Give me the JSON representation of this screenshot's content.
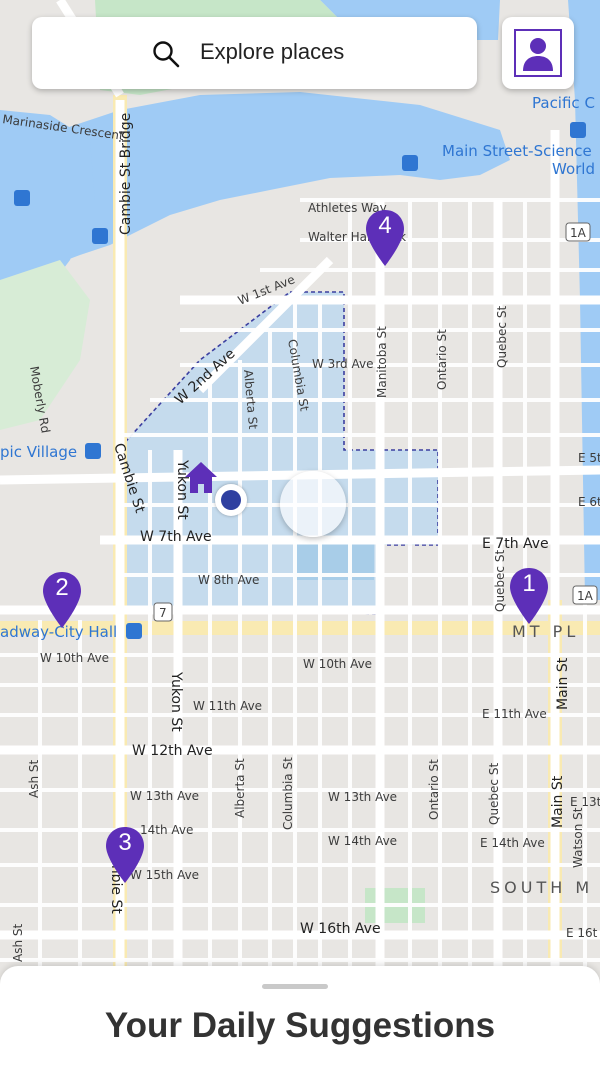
{
  "search": {
    "placeholder": "Explore places"
  },
  "map": {
    "labels": {
      "marinaside": "Marinaside Crescent",
      "cambie_bridge": "Cambie St Bridge",
      "pacific_top": "Pacific C",
      "science_world_1": "Main Street-Science",
      "science_world_2": "World",
      "athletes_way": "Athletes Way",
      "walter_hardwick": "Walter Hardwick",
      "w1st": "W 1st Ave",
      "w2nd": "W 2nd Ave",
      "w3rd": "W 3rd Ave",
      "w7th": "W 7th Ave",
      "w8th": "W 8th Ave",
      "w10th": "W 10th Ave",
      "w10th_b": "W 10th Ave",
      "w11th": "W 11th Ave",
      "e11th": "E 11th Ave",
      "w12th": "W 12th Ave",
      "w13th": "W 13th Ave",
      "w13th_b": "W 13th Ave",
      "w14th": "14th Ave",
      "w14th_b": "W 14th Ave",
      "e14th": "E 14th Ave",
      "w15th": "W 15th Ave",
      "w16th": "W 16th Ave",
      "e16th": "E 16t",
      "e7th": "E 7th Ave",
      "e5th": "E 5t",
      "e6th": "E 6t",
      "e13th": "E 13t",
      "pacific_village": "pic Village",
      "broadway": "adway-City Hall",
      "mt_pl": "MT PL",
      "south": "SOUTH M",
      "columbia": "Columbia St",
      "alberta": "Alberta St",
      "yukon": "Yukon St",
      "yukon_b": "Yukon St",
      "cambie": "Cambie St",
      "cambie_b": "mbie St",
      "manitoba": "Manitoba St",
      "ontario": "Ontario St",
      "quebec": "Quebec St",
      "main": "Main St",
      "main_b": "Main St",
      "moberly": "Moberly Rd",
      "ash": "Ash St",
      "ash_b": "Ash St",
      "watson": "Watson St",
      "hwy_1a": "1A",
      "hwy_7": "7",
      "home_label": "ve"
    }
  },
  "pins": [
    {
      "number": "1"
    },
    {
      "number": "2"
    },
    {
      "number": "3"
    },
    {
      "number": "4"
    }
  ],
  "sheet": {
    "title": "Your Daily Suggestions"
  },
  "colors": {
    "accent": "#5d2fb8",
    "water": "#9fcbf5",
    "park": "#c6e6c8",
    "land": "#e8e6e3",
    "road": "#ffffff",
    "arterial": "#f9eab2",
    "zone": "#b9d7f0"
  }
}
